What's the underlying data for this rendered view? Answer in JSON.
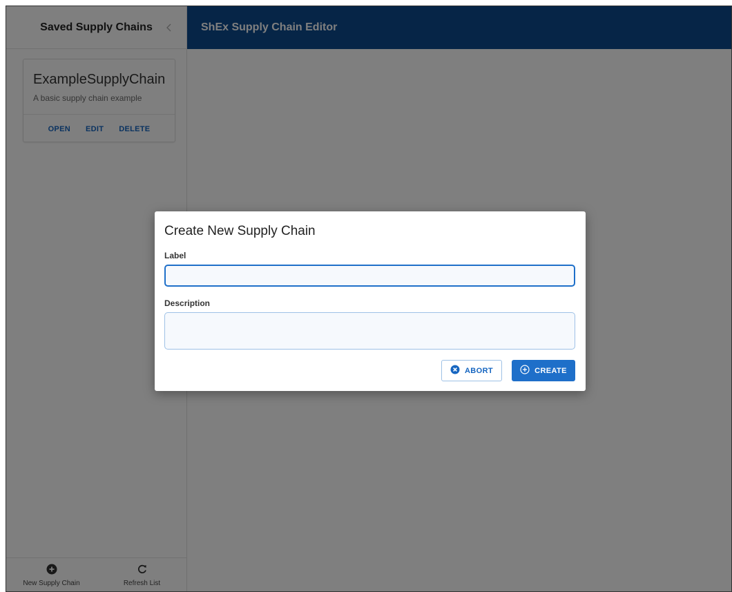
{
  "sidebar": {
    "title": "Saved Supply Chains",
    "card": {
      "title": "ExampleSupplyChain",
      "description": "A basic supply chain example",
      "actions": [
        "OPEN",
        "EDIT",
        "DELETE"
      ]
    },
    "footer": {
      "new_label": "New Supply Chain",
      "refresh_label": "Refresh List"
    }
  },
  "header": {
    "title": "ShEx Supply Chain Editor",
    "color": "#0d4a8f"
  },
  "dialog": {
    "title": "Create New Supply Chain",
    "label_field": {
      "label": "Label",
      "value": "",
      "placeholder": ""
    },
    "description_field": {
      "label": "Description",
      "value": "",
      "placeholder": ""
    },
    "abort_label": "ABORT",
    "create_label": "CREATE"
  },
  "colors": {
    "accent": "#1e6fc9",
    "link": "#1565c0"
  },
  "icons": {
    "collapse": "chevron-left-icon",
    "new": "plus-circle-icon",
    "refresh": "refresh-icon",
    "abort": "times-circle-icon",
    "create": "plus-circle-outline-icon"
  }
}
